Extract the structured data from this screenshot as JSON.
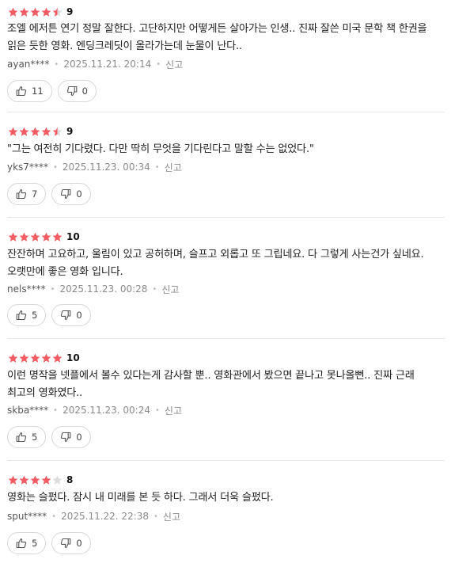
{
  "theme": {
    "star_filled": "#f25c62",
    "star_empty": "#dcdcdc"
  },
  "reviews": [
    {
      "rating_stars": 4.5,
      "score": "9",
      "content": "조엘 에저튼 연기 정말 잘한다. 고단하지만 어떻게든 살아가는 인생.. 진짜 잘쓴 미국 문학 책 한권을 읽은 듯한 영화. 엔딩크레딧이 올라가는데 눈물이 난다..",
      "user": "ayan****",
      "date": "2025.11.21. 20:14",
      "report": "신고",
      "likes": "11",
      "dislikes": "0"
    },
    {
      "rating_stars": 4.5,
      "score": "9",
      "content": "\"그는 여전히 기다렸다. 다만 딱히 무엇을 기다린다고 말할 수는 없었다.\"",
      "user": "yks7****",
      "date": "2025.11.23. 00:34",
      "report": "신고",
      "likes": "7",
      "dislikes": "0"
    },
    {
      "rating_stars": 5,
      "score": "10",
      "content": "잔잔하며 고요하고, 울림이 있고 공허하며, 슬프고 외롭고 또 그립네요. 다 그렇게 사는건가 싶네요. 오랫만에 좋은 영화 입니다.",
      "user": "nels****",
      "date": "2025.11.23. 00:28",
      "report": "신고",
      "likes": "5",
      "dislikes": "0"
    },
    {
      "rating_stars": 5,
      "score": "10",
      "content": "이런 명작을 넷플에서 볼수 있다는게 감사할 뿐.. 영화관에서 봤으면 끝나고 못나올뻔.. 진짜 근래 최고의 영화였다..",
      "user": "skba****",
      "date": "2025.11.23. 00:24",
      "report": "신고",
      "likes": "5",
      "dislikes": "0"
    },
    {
      "rating_stars": 4,
      "score": "8",
      "content": "영화는 슬펐다. 잠시 내 미래를 본 듯 하다. 그래서 더욱 슬펐다.",
      "user": "sput****",
      "date": "2025.11.22. 22:38",
      "report": "신고",
      "likes": "5",
      "dislikes": "0"
    }
  ]
}
